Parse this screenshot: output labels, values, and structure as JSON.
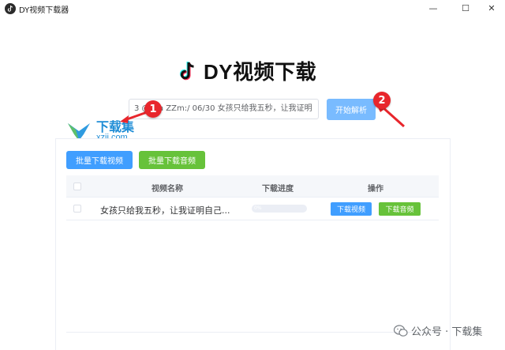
{
  "window": {
    "title": "DY视频下载器",
    "controls": {
      "minimize": "—",
      "maximize": "☐",
      "close": "✕"
    }
  },
  "header": {
    "title": "DY视频下载",
    "logo_icon": "tiktok-note-icon"
  },
  "url_input": {
    "value": "3 @l.ca ZZm:/ 06/30 女孩只给我五秒，让我证明"
  },
  "parse_button": {
    "label": "开始解析"
  },
  "markers": {
    "first": "1",
    "second": "2"
  },
  "watermark": {
    "top": "下载集",
    "bottom": "xzji.com",
    "footer": "公众号 · 下载集"
  },
  "toolbar": {
    "batch_video_label": "批量下载视频",
    "batch_audio_label": "批量下载音频"
  },
  "table": {
    "columns": [
      "视频名称",
      "下载进度",
      "操作"
    ],
    "rows": [
      {
        "name": "女孩只给我五秒，让我证明自己...",
        "progress_text": "0%",
        "progress": 0,
        "video_btn": "下载视频",
        "audio_btn": "下载音频"
      }
    ]
  },
  "colors": {
    "primary": "#409eff",
    "primary_light": "#79bbff",
    "success": "#67c23a",
    "marker_red": "#e8262c",
    "watermark_blue": "#1f8dd6"
  }
}
